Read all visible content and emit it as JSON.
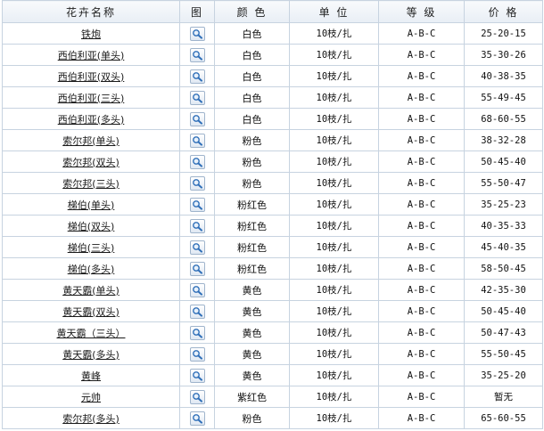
{
  "headers": {
    "name": "花卉名称",
    "image": "图",
    "color": "颜 色",
    "unit": "单 位",
    "grade": "等 级",
    "price": "价 格"
  },
  "rows": [
    {
      "name": "铁炮",
      "color": "白色",
      "unit": "10枝/扎",
      "grade": "A-B-C",
      "price": "25-20-15"
    },
    {
      "name": "西伯利亚(单头)",
      "color": "白色",
      "unit": "10枝/扎",
      "grade": "A-B-C",
      "price": "35-30-26"
    },
    {
      "name": "西伯利亚(双头)",
      "color": "白色",
      "unit": "10枝/扎",
      "grade": "A-B-C",
      "price": "40-38-35"
    },
    {
      "name": "西伯利亚(三头)",
      "color": "白色",
      "unit": "10枝/扎",
      "grade": "A-B-C",
      "price": "55-49-45"
    },
    {
      "name": "西伯利亚(多头)",
      "color": "白色",
      "unit": "10枝/扎",
      "grade": "A-B-C",
      "price": "68-60-55"
    },
    {
      "name": "索尔邦(单头)",
      "color": "粉色",
      "unit": "10枝/扎",
      "grade": "A-B-C",
      "price": "38-32-28"
    },
    {
      "name": "索尔邦(双头)",
      "color": "粉色",
      "unit": "10枝/扎",
      "grade": "A-B-C",
      "price": "50-45-40"
    },
    {
      "name": "索尔邦(三头)",
      "color": "粉色",
      "unit": "10枝/扎",
      "grade": "A-B-C",
      "price": "55-50-47"
    },
    {
      "name": "梯伯(单头)",
      "color": "粉红色",
      "unit": "10枝/扎",
      "grade": "A-B-C",
      "price": "35-25-23"
    },
    {
      "name": "梯伯(双头)",
      "color": "粉红色",
      "unit": "10枝/扎",
      "grade": "A-B-C",
      "price": "40-35-33"
    },
    {
      "name": "梯伯(三头)",
      "color": "粉红色",
      "unit": "10枝/扎",
      "grade": "A-B-C",
      "price": "45-40-35"
    },
    {
      "name": "梯伯(多头)",
      "color": "粉红色",
      "unit": "10枝/扎",
      "grade": "A-B-C",
      "price": "58-50-45"
    },
    {
      "name": "黄天霸(单头)",
      "color": "黄色",
      "unit": "10枝/扎",
      "grade": "A-B-C",
      "price": "42-35-30"
    },
    {
      "name": "黄天霸(双头)",
      "color": "黄色",
      "unit": "10枝/扎",
      "grade": "A-B-C",
      "price": "50-45-40"
    },
    {
      "name": "黄天霸（三头）",
      "color": "黄色",
      "unit": "10枝/扎",
      "grade": "A-B-C",
      "price": "50-47-43"
    },
    {
      "name": "黄天霸(多头)",
      "color": "黄色",
      "unit": "10枝/扎",
      "grade": "A-B-C",
      "price": "55-50-45"
    },
    {
      "name": "黄峰",
      "color": "黄色",
      "unit": "10枝/扎",
      "grade": "A-B-C",
      "price": "35-25-20"
    },
    {
      "name": "元帅",
      "color": "紫红色",
      "unit": "10枝/扎",
      "grade": "A-B-C",
      "price": "暂无"
    },
    {
      "name": "索尔邦(多头)",
      "color": "粉色",
      "unit": "10枝/扎",
      "grade": "A-B-C",
      "price": "65-60-55"
    }
  ],
  "row_icon": "magnifier-icon",
  "colors": {
    "border": "#c7d3e0",
    "header_bg": "#e8eef5",
    "icon_blue": "#2f6fb8"
  }
}
